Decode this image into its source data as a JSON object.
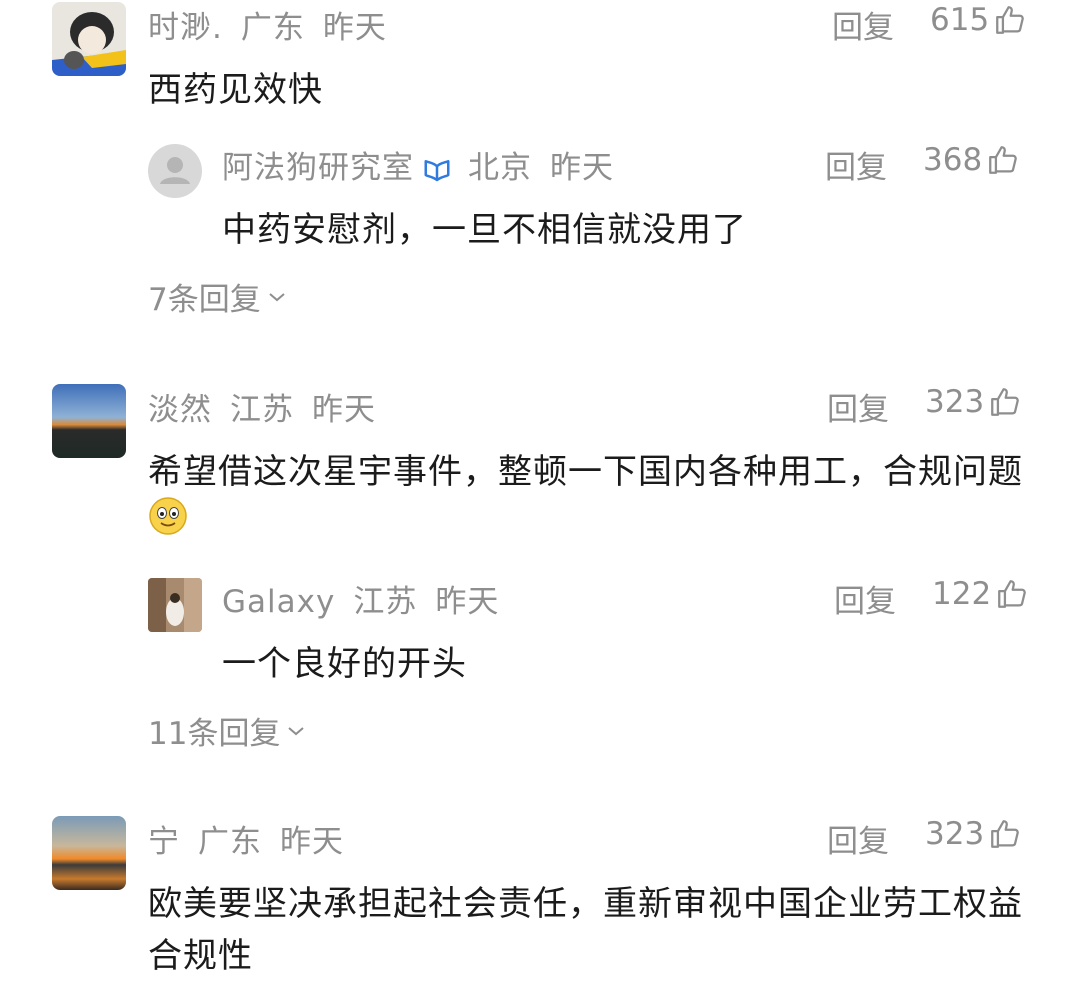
{
  "comments": [
    {
      "user": "时渺.",
      "location": "广东",
      "time": "昨天",
      "reply_label": "回复",
      "likes": "615",
      "text": "西药见效快",
      "sub": {
        "user": "阿法狗研究室",
        "location": "北京",
        "time": "昨天",
        "reply_label": "回复",
        "likes": "368",
        "text": "中药安慰剂，一旦不相信就没用了"
      },
      "more_replies": "7条回复"
    },
    {
      "user": "淡然",
      "location": "江苏",
      "time": "昨天",
      "reply_label": "回复",
      "likes": "323",
      "text": "希望借这次星宇事件，整顿一下国内各种用工，合规问题",
      "sub": {
        "user": "Galaxy",
        "location": "江苏",
        "time": "昨天",
        "reply_label": "回复",
        "likes": "122",
        "text": "一个良好的开头"
      },
      "more_replies": "11条回复"
    },
    {
      "user": "宁",
      "location": "广东",
      "time": "昨天",
      "reply_label": "回复",
      "likes": "323",
      "text_line1": "欧美要坚决承担起社会责任，重新审视中国企业劳工权益",
      "text_line2": "合规性"
    }
  ],
  "colors": {
    "meta": "#8e8e8e",
    "text": "#1b1b1b",
    "vip": "#2f7be0"
  },
  "icons": {
    "like": "thumbs-up-icon",
    "chevron": "chevron-down-icon",
    "vip": "verified-badge-icon",
    "emoji": "smile-emoji-icon"
  }
}
